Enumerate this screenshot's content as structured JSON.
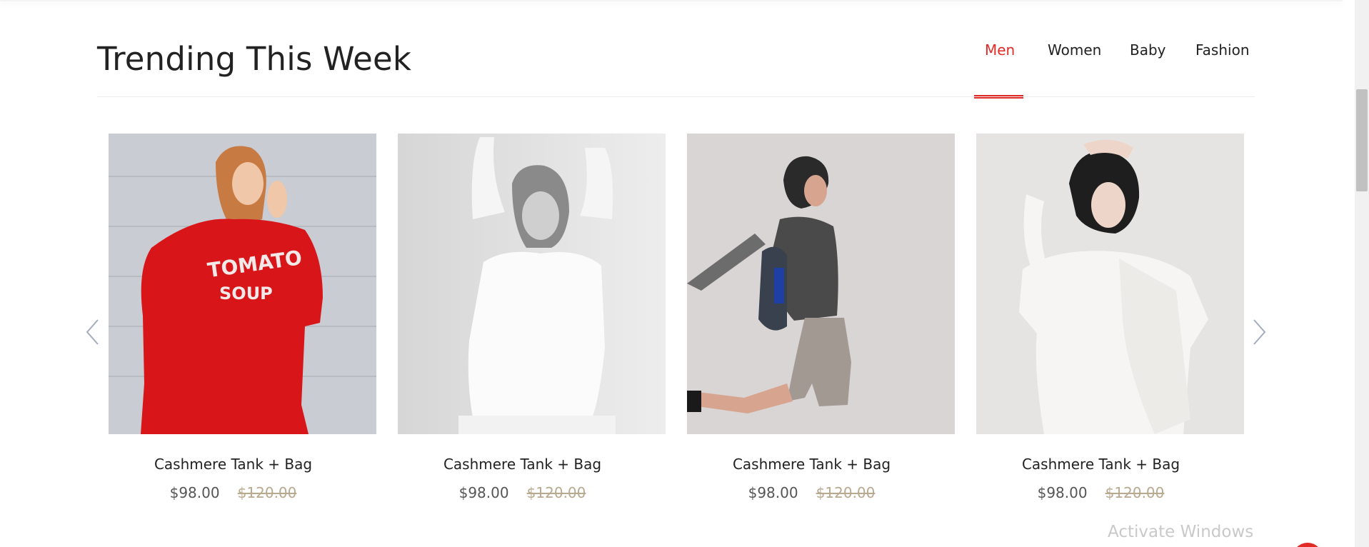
{
  "section": {
    "title": "Trending This Week"
  },
  "tabs": [
    {
      "label": "Men",
      "active": true
    },
    {
      "label": "Women",
      "active": false
    },
    {
      "label": "Baby",
      "active": false
    },
    {
      "label": "Fashion",
      "active": false
    }
  ],
  "colors": {
    "accent": "#e02b27",
    "old_price": "#b8a98f",
    "text": "#222222"
  },
  "products": [
    {
      "name": "Cashmere Tank + Bag",
      "price": "$98.00",
      "old_price": "$120.00",
      "image_icon": "photo-woman-red-sweatshirt"
    },
    {
      "name": "Cashmere Tank + Bag",
      "price": "$98.00",
      "old_price": "$120.00",
      "image_icon": "photo-woman-white-top-bw"
    },
    {
      "name": "Cashmere Tank + Bag",
      "price": "$98.00",
      "old_price": "$120.00",
      "image_icon": "photo-man-walking-jacket"
    },
    {
      "name": "Cashmere Tank + Bag",
      "price": "$98.00",
      "old_price": "$120.00",
      "image_icon": "photo-woman-white-shirt"
    }
  ],
  "photo_texts": {
    "sweatshirt_line1": "TOMATO",
    "sweatshirt_line2": "SOUP"
  },
  "carousel": {
    "prev_icon": "chevron-left-icon",
    "next_icon": "chevron-right-icon"
  },
  "watermark": "Activate Windows"
}
